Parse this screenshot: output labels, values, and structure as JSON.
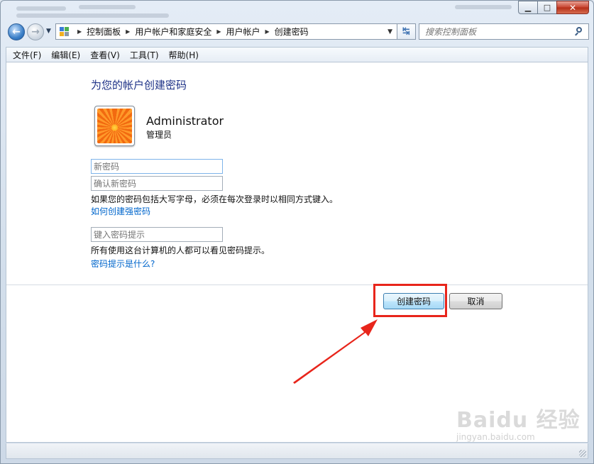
{
  "window": {
    "caption": {
      "minimize": "▁",
      "maximize": "□",
      "close": "✕"
    }
  },
  "navigation": {
    "back_icon": "back-arrow-icon",
    "forward_icon": "forward-arrow-icon",
    "breadcrumb": [
      "控制面板",
      "用户帐户和家庭安全",
      "用户帐户",
      "创建密码"
    ],
    "search_placeholder": "搜索控制面板"
  },
  "menu": [
    "文件(F)",
    "编辑(E)",
    "查看(V)",
    "工具(T)",
    "帮助(H)"
  ],
  "page": {
    "heading": "为您的帐户创建密码",
    "user": {
      "name": "Administrator",
      "role": "管理员"
    },
    "new_password_placeholder": "新密码",
    "confirm_password_placeholder": "确认新密码",
    "caps_note": "如果您的密码包括大写字母，必须在每次登录时以相同方式键入。",
    "strong_password_link": "如何创建强密码",
    "hint_placeholder": "键入密码提示",
    "hint_note": "所有使用这台计算机的人都可以看见密码提示。",
    "hint_help_link": "密码提示是什么?",
    "create_button": "创建密码",
    "cancel_button": "取消"
  },
  "annotation": {
    "highlight_color": "#e8251b"
  },
  "watermark": {
    "brand": "Baidu 经验",
    "url": "jingyan.baidu.com"
  }
}
